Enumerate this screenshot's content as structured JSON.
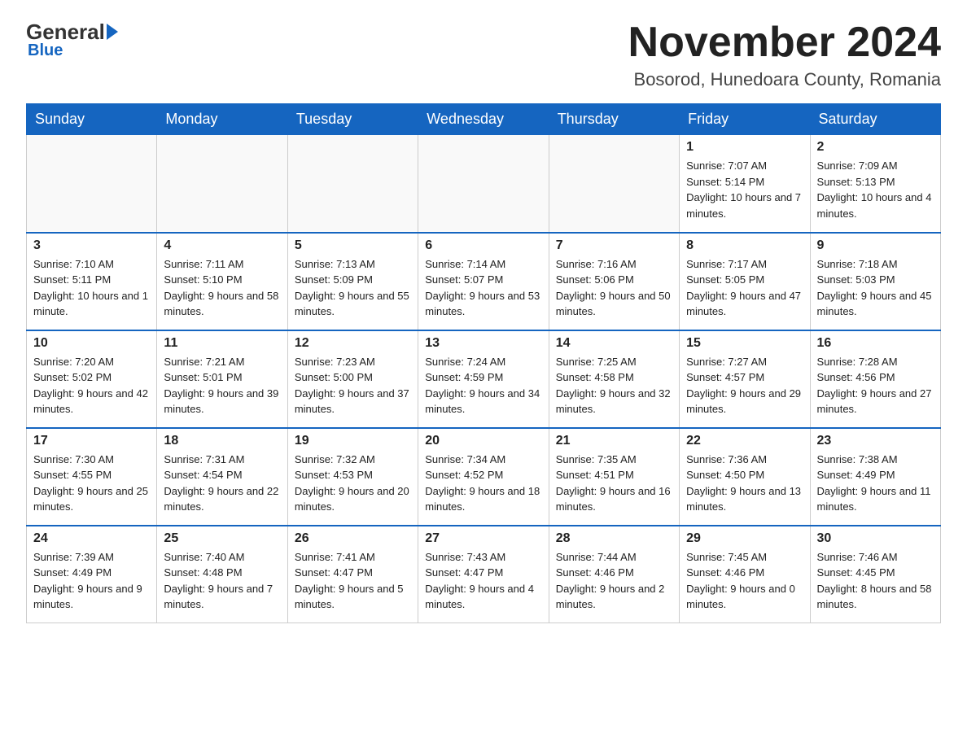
{
  "logo": {
    "name_black": "General",
    "name_blue": "Blue",
    "sub": "Blue"
  },
  "header": {
    "month_year": "November 2024",
    "location": "Bosorod, Hunedoara County, Romania"
  },
  "days_of_week": [
    "Sunday",
    "Monday",
    "Tuesday",
    "Wednesday",
    "Thursday",
    "Friday",
    "Saturday"
  ],
  "weeks": [
    [
      {
        "day": "",
        "sunrise": "",
        "sunset": "",
        "daylight": ""
      },
      {
        "day": "",
        "sunrise": "",
        "sunset": "",
        "daylight": ""
      },
      {
        "day": "",
        "sunrise": "",
        "sunset": "",
        "daylight": ""
      },
      {
        "day": "",
        "sunrise": "",
        "sunset": "",
        "daylight": ""
      },
      {
        "day": "",
        "sunrise": "",
        "sunset": "",
        "daylight": ""
      },
      {
        "day": "1",
        "sunrise": "Sunrise: 7:07 AM",
        "sunset": "Sunset: 5:14 PM",
        "daylight": "Daylight: 10 hours and 7 minutes."
      },
      {
        "day": "2",
        "sunrise": "Sunrise: 7:09 AM",
        "sunset": "Sunset: 5:13 PM",
        "daylight": "Daylight: 10 hours and 4 minutes."
      }
    ],
    [
      {
        "day": "3",
        "sunrise": "Sunrise: 7:10 AM",
        "sunset": "Sunset: 5:11 PM",
        "daylight": "Daylight: 10 hours and 1 minute."
      },
      {
        "day": "4",
        "sunrise": "Sunrise: 7:11 AM",
        "sunset": "Sunset: 5:10 PM",
        "daylight": "Daylight: 9 hours and 58 minutes."
      },
      {
        "day": "5",
        "sunrise": "Sunrise: 7:13 AM",
        "sunset": "Sunset: 5:09 PM",
        "daylight": "Daylight: 9 hours and 55 minutes."
      },
      {
        "day": "6",
        "sunrise": "Sunrise: 7:14 AM",
        "sunset": "Sunset: 5:07 PM",
        "daylight": "Daylight: 9 hours and 53 minutes."
      },
      {
        "day": "7",
        "sunrise": "Sunrise: 7:16 AM",
        "sunset": "Sunset: 5:06 PM",
        "daylight": "Daylight: 9 hours and 50 minutes."
      },
      {
        "day": "8",
        "sunrise": "Sunrise: 7:17 AM",
        "sunset": "Sunset: 5:05 PM",
        "daylight": "Daylight: 9 hours and 47 minutes."
      },
      {
        "day": "9",
        "sunrise": "Sunrise: 7:18 AM",
        "sunset": "Sunset: 5:03 PM",
        "daylight": "Daylight: 9 hours and 45 minutes."
      }
    ],
    [
      {
        "day": "10",
        "sunrise": "Sunrise: 7:20 AM",
        "sunset": "Sunset: 5:02 PM",
        "daylight": "Daylight: 9 hours and 42 minutes."
      },
      {
        "day": "11",
        "sunrise": "Sunrise: 7:21 AM",
        "sunset": "Sunset: 5:01 PM",
        "daylight": "Daylight: 9 hours and 39 minutes."
      },
      {
        "day": "12",
        "sunrise": "Sunrise: 7:23 AM",
        "sunset": "Sunset: 5:00 PM",
        "daylight": "Daylight: 9 hours and 37 minutes."
      },
      {
        "day": "13",
        "sunrise": "Sunrise: 7:24 AM",
        "sunset": "Sunset: 4:59 PM",
        "daylight": "Daylight: 9 hours and 34 minutes."
      },
      {
        "day": "14",
        "sunrise": "Sunrise: 7:25 AM",
        "sunset": "Sunset: 4:58 PM",
        "daylight": "Daylight: 9 hours and 32 minutes."
      },
      {
        "day": "15",
        "sunrise": "Sunrise: 7:27 AM",
        "sunset": "Sunset: 4:57 PM",
        "daylight": "Daylight: 9 hours and 29 minutes."
      },
      {
        "day": "16",
        "sunrise": "Sunrise: 7:28 AM",
        "sunset": "Sunset: 4:56 PM",
        "daylight": "Daylight: 9 hours and 27 minutes."
      }
    ],
    [
      {
        "day": "17",
        "sunrise": "Sunrise: 7:30 AM",
        "sunset": "Sunset: 4:55 PM",
        "daylight": "Daylight: 9 hours and 25 minutes."
      },
      {
        "day": "18",
        "sunrise": "Sunrise: 7:31 AM",
        "sunset": "Sunset: 4:54 PM",
        "daylight": "Daylight: 9 hours and 22 minutes."
      },
      {
        "day": "19",
        "sunrise": "Sunrise: 7:32 AM",
        "sunset": "Sunset: 4:53 PM",
        "daylight": "Daylight: 9 hours and 20 minutes."
      },
      {
        "day": "20",
        "sunrise": "Sunrise: 7:34 AM",
        "sunset": "Sunset: 4:52 PM",
        "daylight": "Daylight: 9 hours and 18 minutes."
      },
      {
        "day": "21",
        "sunrise": "Sunrise: 7:35 AM",
        "sunset": "Sunset: 4:51 PM",
        "daylight": "Daylight: 9 hours and 16 minutes."
      },
      {
        "day": "22",
        "sunrise": "Sunrise: 7:36 AM",
        "sunset": "Sunset: 4:50 PM",
        "daylight": "Daylight: 9 hours and 13 minutes."
      },
      {
        "day": "23",
        "sunrise": "Sunrise: 7:38 AM",
        "sunset": "Sunset: 4:49 PM",
        "daylight": "Daylight: 9 hours and 11 minutes."
      }
    ],
    [
      {
        "day": "24",
        "sunrise": "Sunrise: 7:39 AM",
        "sunset": "Sunset: 4:49 PM",
        "daylight": "Daylight: 9 hours and 9 minutes."
      },
      {
        "day": "25",
        "sunrise": "Sunrise: 7:40 AM",
        "sunset": "Sunset: 4:48 PM",
        "daylight": "Daylight: 9 hours and 7 minutes."
      },
      {
        "day": "26",
        "sunrise": "Sunrise: 7:41 AM",
        "sunset": "Sunset: 4:47 PM",
        "daylight": "Daylight: 9 hours and 5 minutes."
      },
      {
        "day": "27",
        "sunrise": "Sunrise: 7:43 AM",
        "sunset": "Sunset: 4:47 PM",
        "daylight": "Daylight: 9 hours and 4 minutes."
      },
      {
        "day": "28",
        "sunrise": "Sunrise: 7:44 AM",
        "sunset": "Sunset: 4:46 PM",
        "daylight": "Daylight: 9 hours and 2 minutes."
      },
      {
        "day": "29",
        "sunrise": "Sunrise: 7:45 AM",
        "sunset": "Sunset: 4:46 PM",
        "daylight": "Daylight: 9 hours and 0 minutes."
      },
      {
        "day": "30",
        "sunrise": "Sunrise: 7:46 AM",
        "sunset": "Sunset: 4:45 PM",
        "daylight": "Daylight: 8 hours and 58 minutes."
      }
    ]
  ]
}
